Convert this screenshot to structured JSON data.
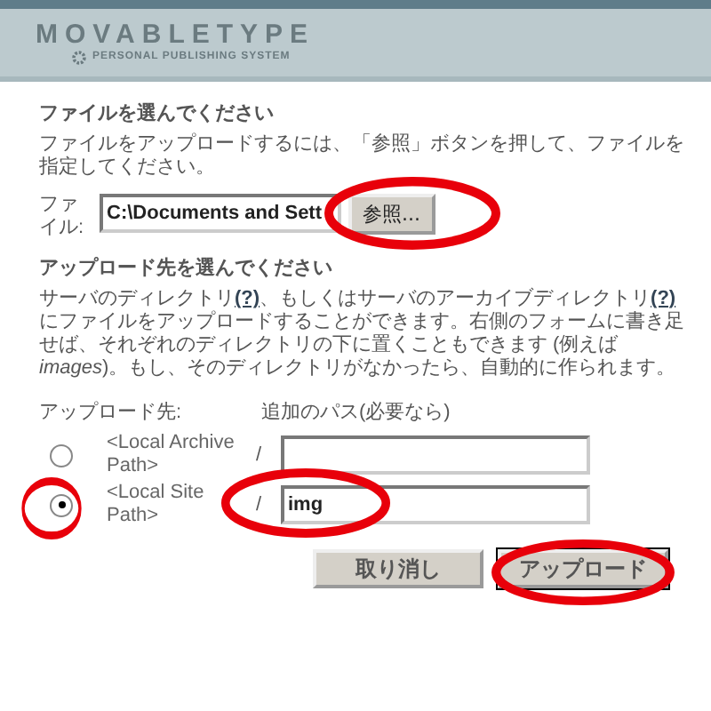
{
  "header": {
    "logo": "MOVABLETYPE",
    "tagline": "PERSONAL PUBLISHING SYSTEM"
  },
  "file_section": {
    "heading": "ファイルを選んでください",
    "description": "ファイルをアップロードするには、「参照」ボタンを押して、ファイルを指定してください。",
    "label": "ファイル:",
    "value": "C:\\Documents and Sett",
    "browse_button": {
      "label": "参照...",
      "circled": true
    }
  },
  "destination_section": {
    "heading": "アップロード先を選んでください",
    "description": [
      {
        "kind": "text",
        "text": "サーバのディレクトリ"
      },
      {
        "kind": "link",
        "text": "(?)"
      },
      {
        "kind": "text",
        "text": "、もしくはサーバのアーカイブディレクトリ"
      },
      {
        "kind": "link",
        "text": "(?)"
      },
      {
        "kind": "text",
        "text": "にファイルをアップロードすることができます。右側のフォームに書き足せば、それぞれのディレクトリの下に置くこともできます (例えば *images*)。もし、そのディレクトリがなかったら、自動的に作られます。"
      }
    ],
    "destination_label": "アップロード先:",
    "path_label": "追加のパス(必要なら)",
    "options": [
      {
        "label": "<Local Archive Path>",
        "separator": "/",
        "selected": false,
        "circled": false,
        "value_circled": false
      },
      {
        "label": "<Local Site Path>",
        "separator": "/",
        "value": "img",
        "selected": true,
        "circled": true,
        "value_circled": true
      }
    ]
  },
  "buttons": [
    {
      "label": "取り消し",
      "default": false,
      "circled": false
    },
    {
      "label": "アップロード",
      "default": true,
      "circled": true
    }
  ]
}
